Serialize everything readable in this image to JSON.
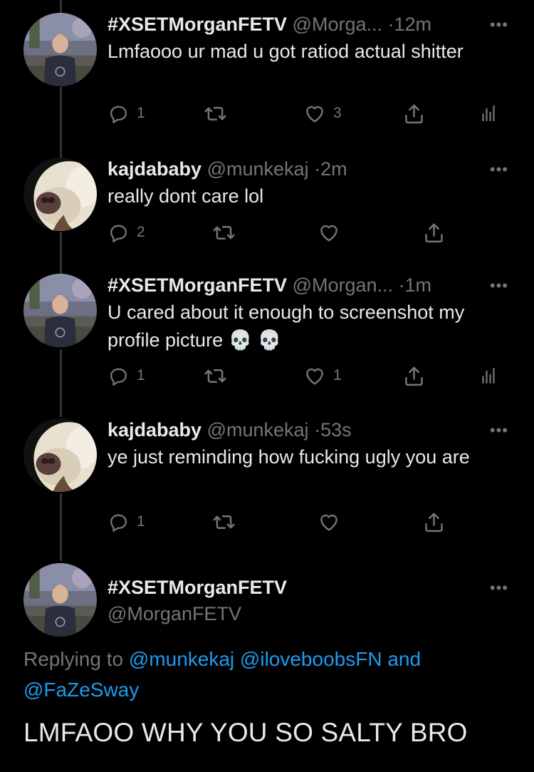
{
  "colors": {
    "background": "#000000",
    "text": "#e7e9ea",
    "muted": "#71767b",
    "link": "#1d9bf0"
  },
  "tweets": [
    {
      "name": "#XSETMorganFETV",
      "handle": "@Morga...",
      "separator": "·",
      "time": "12m",
      "text": "Lmfaooo ur mad u got ratiod actual shitter",
      "replies": "1",
      "retweets": "",
      "likes": "3",
      "avatar": "morgan-avatar"
    },
    {
      "name": "kajdababy",
      "handle": "@munkekaj",
      "separator": "·",
      "time": "2m",
      "text": "really dont care lol",
      "replies": "2",
      "retweets": "",
      "likes": "",
      "avatar": "dog-avatar"
    },
    {
      "name": "#XSETMorganFETV",
      "handle": "@Morgan...",
      "separator": "·",
      "time": "1m",
      "text": "U cared about it enough to screenshot my profile picture 💀 💀",
      "replies": "1",
      "retweets": "",
      "likes": "1",
      "avatar": "morgan-avatar"
    },
    {
      "name": "kajdababy",
      "handle": "@munkekaj",
      "separator": "·",
      "time": "53s",
      "text": "ye just reminding how fucking ugly you are",
      "replies": "1",
      "retweets": "",
      "likes": "",
      "avatar": "dog-avatar"
    }
  ],
  "main_tweet": {
    "name": "#XSETMorganFETV",
    "handle": "@MorganFETV",
    "replying_prefix": "Replying to",
    "mention_1": "@munkekaj",
    "mention_2": "@iloveboobsFN",
    "and_word": "and",
    "mention_3": "@FaZeSway",
    "text": "LMFAOO WHY YOU SO SALTY BRO"
  },
  "icons": {
    "more": "more-horizontal-icon",
    "reply": "reply-icon",
    "retweet": "retweet-icon",
    "like": "heart-icon",
    "share": "share-icon",
    "analytics": "analytics-icon"
  },
  "more_glyph": "•••"
}
